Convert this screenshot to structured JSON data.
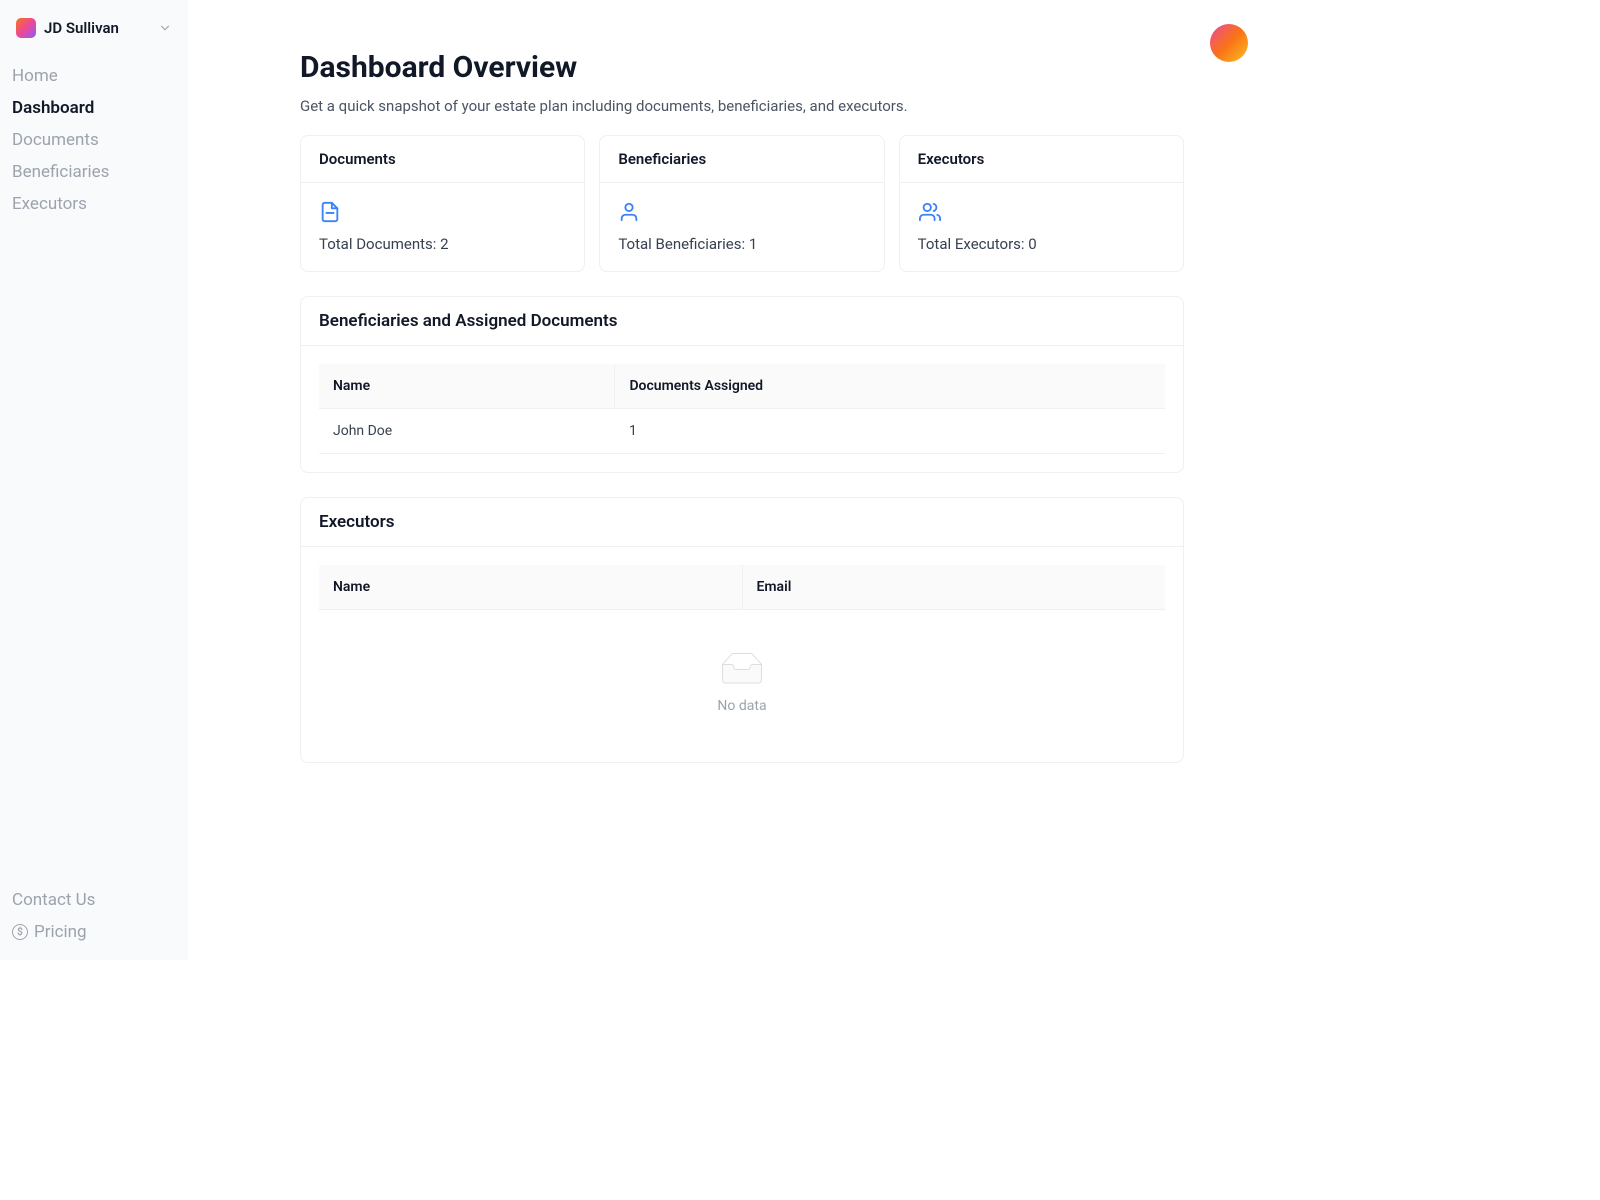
{
  "user": {
    "name": "JD Sullivan"
  },
  "sidebar": {
    "items": [
      {
        "label": "Home",
        "active": false
      },
      {
        "label": "Dashboard",
        "active": true
      },
      {
        "label": "Documents",
        "active": false
      },
      {
        "label": "Beneficiaries",
        "active": false
      },
      {
        "label": "Executors",
        "active": false
      }
    ],
    "footer": [
      {
        "label": "Contact Us",
        "icon": null
      },
      {
        "label": "Pricing",
        "icon": "dollar"
      }
    ]
  },
  "header": {
    "title": "Dashboard Overview",
    "subtitle": "Get a quick snapshot of your estate plan including documents, beneficiaries, and executors."
  },
  "stats": {
    "documents": {
      "title": "Documents",
      "label": "Total Documents:",
      "value": 2
    },
    "beneficiaries": {
      "title": "Beneficiaries",
      "label": "Total Beneficiaries:",
      "value": 1
    },
    "executors": {
      "title": "Executors",
      "label": "Total Executors:",
      "value": 0
    }
  },
  "beneficiaries_section": {
    "title": "Beneficiaries and Assigned Documents",
    "columns": [
      "Name",
      "Documents Assigned"
    ],
    "rows": [
      {
        "name": "John Doe",
        "docs_assigned": 1
      }
    ]
  },
  "executors_section": {
    "title": "Executors",
    "columns": [
      "Name",
      "Email"
    ],
    "empty_text": "No data"
  }
}
